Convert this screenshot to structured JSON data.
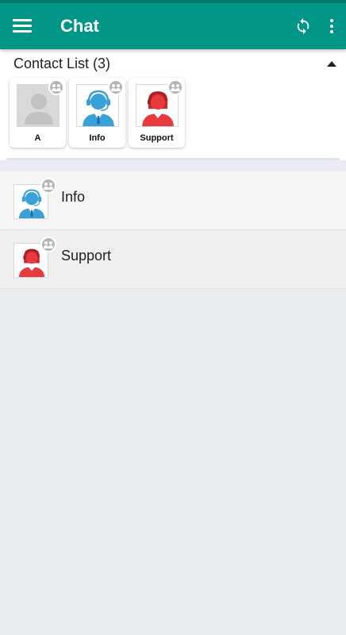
{
  "appbar": {
    "title": "Chat",
    "menu_icon": "hamburger-icon",
    "sync_icon": "sync-icon",
    "more_icon": "more-vert-icon",
    "bg_color": "#019687"
  },
  "contact_list": {
    "title": "Contact List (3)",
    "collapse_icon": "triangle-up-icon",
    "cards": [
      {
        "label": "A",
        "avatar": "default-person-icon"
      },
      {
        "label": "Info",
        "avatar": "agent-blue-icon"
      },
      {
        "label": "Support",
        "avatar": "agent-red-icon"
      }
    ]
  },
  "chats": [
    {
      "name": "Info",
      "avatar": "agent-blue-icon"
    },
    {
      "name": "Support",
      "avatar": "agent-red-icon"
    }
  ],
  "colors": {
    "primary": "#019687",
    "agent_blue": "#3aa0d8",
    "agent_red": "#e8393c",
    "badge": "#b5b5b5"
  }
}
